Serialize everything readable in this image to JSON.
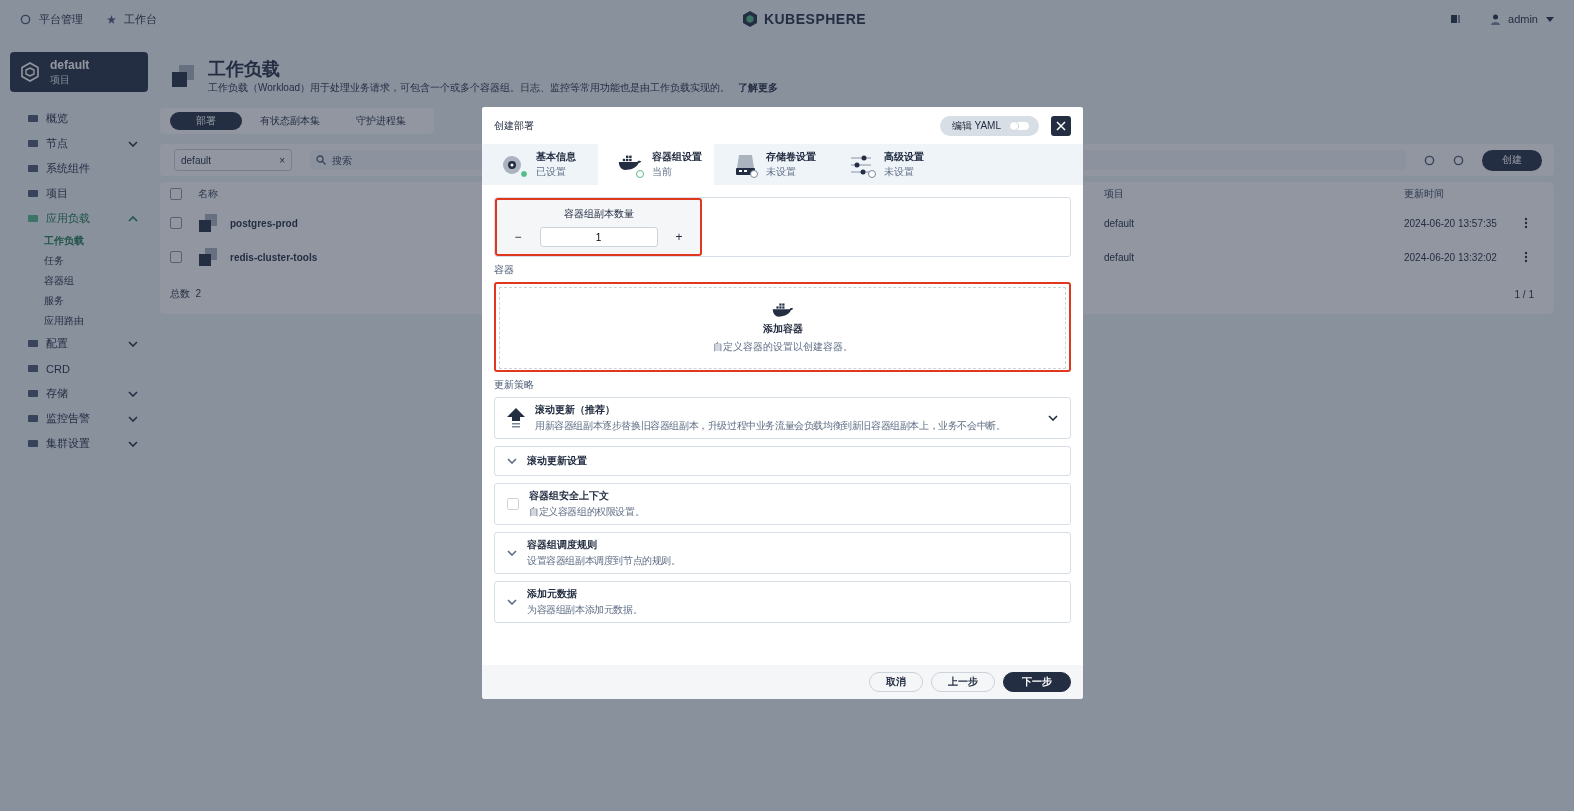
{
  "topbar": {
    "nav": [
      {
        "label": "平台管理"
      },
      {
        "label": "工作台"
      }
    ],
    "logo": "KUBESPHERE",
    "user": "admin"
  },
  "sidebar": {
    "workspace": {
      "name": "default",
      "type": "项目"
    },
    "items": [
      {
        "label": "概览"
      },
      {
        "label": "节点",
        "expanded": false
      },
      {
        "label": "系统组件"
      },
      {
        "label": "项目"
      },
      {
        "label": "应用负载",
        "expanded": true,
        "children": [
          {
            "label": "工作负载",
            "selected": true
          },
          {
            "label": "任务",
            "selected": false
          },
          {
            "label": "容器组",
            "selected": false
          },
          {
            "label": "服务",
            "selected": false
          },
          {
            "label": "应用路由",
            "selected": false
          }
        ]
      },
      {
        "label": "配置",
        "expanded": false
      },
      {
        "label": "CRD"
      },
      {
        "label": "存储",
        "expanded": false
      },
      {
        "label": "监控告警",
        "expanded": false
      },
      {
        "label": "集群设置",
        "expanded": false
      }
    ]
  },
  "page": {
    "title": "工作负载",
    "description": "工作负载（Workload）用于处理业务请求，可包含一个或多个容器组。日志、监控等常用功能也是由工作负载实现的。",
    "link": "了解更多",
    "tabs": [
      {
        "label": "部署",
        "selected": true
      },
      {
        "label": "有状态副本集",
        "selected": false
      },
      {
        "label": "守护进程集",
        "selected": false
      }
    ],
    "filter": {
      "tag": "default",
      "clear": "×"
    },
    "search": {
      "placeholder": "搜索"
    },
    "create_button": "创建",
    "table": {
      "columns": [
        "名称",
        "项目",
        "更新时间"
      ],
      "all_checked": false,
      "rows": [
        {
          "name": "postgres-prod",
          "project": "default",
          "updated": "2024-06-20 13:57:35",
          "checked": false
        },
        {
          "name": "redis-cluster-tools",
          "project": "default",
          "updated": "2024-06-20 13:32:02",
          "checked": false
        }
      ]
    },
    "total_label": "总数",
    "total": "2",
    "pagination": "1 / 1"
  },
  "modal": {
    "title": "创建部署",
    "yaml_button": "编辑 YAML",
    "yaml_on": false,
    "steps": [
      {
        "title": "基本信息",
        "status": "已设置",
        "done": true,
        "selected": false
      },
      {
        "title": "容器组设置",
        "status": "当前",
        "done": false,
        "selected": true
      },
      {
        "title": "存储卷设置",
        "status": "未设置",
        "done": false,
        "selected": false
      },
      {
        "title": "高级设置",
        "status": "未设置",
        "done": false,
        "selected": false
      }
    ],
    "replicas": {
      "label": "容器组副本数量",
      "value": "1",
      "minus": "−",
      "plus": "+"
    },
    "containers_label": "容器",
    "add_container": {
      "title": "添加容器",
      "description": "自定义容器的设置以创建容器。"
    },
    "strategy_label": "更新策略",
    "strategy": {
      "title": "滚动更新（推荐）",
      "description": "用新容器组副本逐步替换旧容器组副本，升级过程中业务流量会负载均衡到新旧容器组副本上，业务不会中断。"
    },
    "sections": [
      {
        "kind": "collapse",
        "title": "滚动更新设置",
        "expanded": false
      },
      {
        "kind": "checkbox",
        "title": "容器组安全上下文",
        "description": "自定义容器组的权限设置。",
        "checked": false
      },
      {
        "kind": "collapse",
        "title": "容器组调度规则",
        "description": "设置容器组副本调度到节点的规则。",
        "expanded": false
      },
      {
        "kind": "collapse",
        "title": "添加元数据",
        "description": "为容器组副本添加元数据。",
        "expanded": false
      }
    ],
    "buttons": [
      {
        "label": "取消",
        "kind": "default"
      },
      {
        "label": "上一步",
        "kind": "default"
      },
      {
        "label": "下一步",
        "kind": "primary"
      }
    ]
  }
}
